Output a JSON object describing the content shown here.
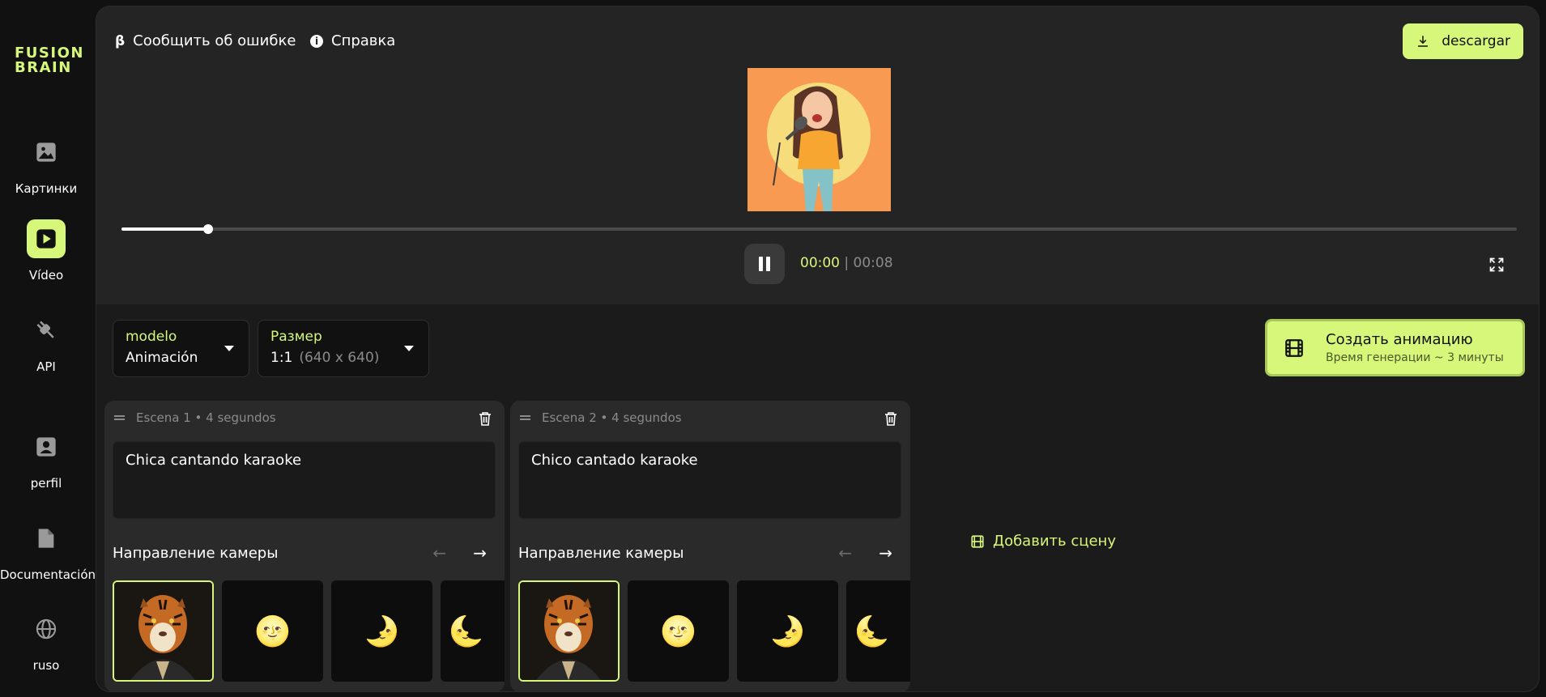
{
  "brand": {
    "line1": "FUSION",
    "line2": "BRAIN"
  },
  "sidebar": {
    "items": [
      {
        "label": "Картинки",
        "icon": "image-icon",
        "active": false
      },
      {
        "label": "Vídeo",
        "icon": "play-icon",
        "active": true
      },
      {
        "label": "API",
        "icon": "plug-icon",
        "active": false
      },
      {
        "label": "perfil",
        "icon": "profile-icon",
        "active": false
      },
      {
        "label": "Documentación",
        "icon": "document-icon",
        "active": false
      },
      {
        "label": "ruso",
        "icon": "globe-icon",
        "active": false
      }
    ]
  },
  "topbar": {
    "report_icon": "β",
    "report_label": "Сообщить об ошибке",
    "help_label": "Справка",
    "download_label": "descargar"
  },
  "player": {
    "current_time": "00:00",
    "separator": "|",
    "duration": "00:08",
    "progress_fraction": 0.062
  },
  "controls": {
    "model": {
      "label": "modelo",
      "value": "Animación"
    },
    "size": {
      "label": "Размер",
      "value": "1:1",
      "detail": "(640 x 640)"
    },
    "create": {
      "title": "Создать анимацию",
      "subtitle": "Время генерации ~ 3 минуты"
    }
  },
  "scenes": [
    {
      "header": "Escena 1 • 4 segundos",
      "prompt": "Chica cantando karaoke",
      "camera_title": "Направление камеры",
      "thumbs": [
        "tiger-portrait",
        "🌝",
        "🌛",
        "🌜"
      ]
    },
    {
      "header": "Escena 2 • 4 segundos",
      "prompt": "Chico cantado karaoke",
      "camera_title": "Направление камеры",
      "thumbs": [
        "tiger-portrait",
        "🌝",
        "🌛",
        "🌜"
      ]
    }
  ],
  "add_scene_label": "Добавить сцену",
  "colors": {
    "accent": "#d6f77a",
    "panel": "#1b1b1b",
    "player_bg": "#242424"
  }
}
